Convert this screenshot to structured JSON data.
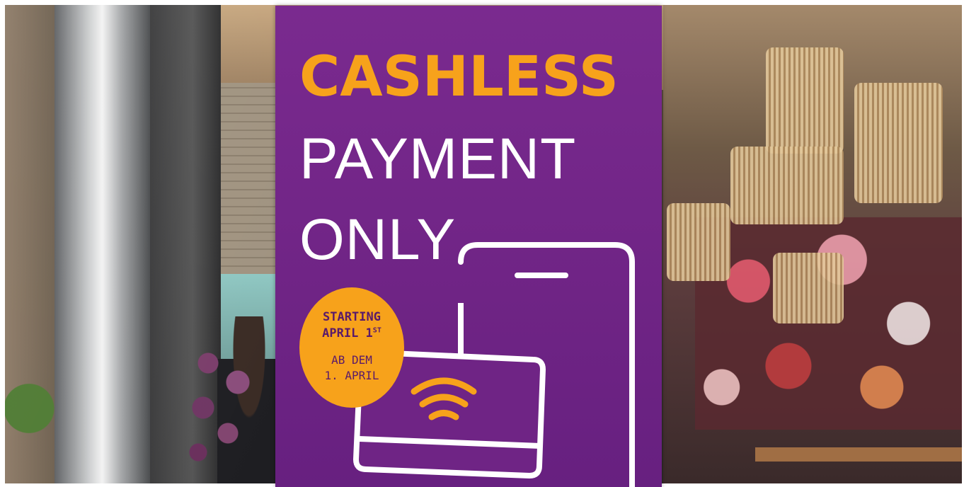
{
  "poster": {
    "line1": "CASHLESS",
    "line2": "PAYMENT",
    "line3": "ONLY",
    "badge": {
      "en_line1": "STARTING",
      "en_line2": "APRIL 1",
      "en_sup": "ST",
      "de_line1": "AB DEM",
      "de_line2": "1. APRIL"
    }
  },
  "colors": {
    "poster_purple": "#6f2485",
    "accent_orange": "#f7a21b",
    "text_white": "#ffffff"
  },
  "icons": [
    "smartphone-icon",
    "payment-card-icon",
    "contactless-icon"
  ]
}
